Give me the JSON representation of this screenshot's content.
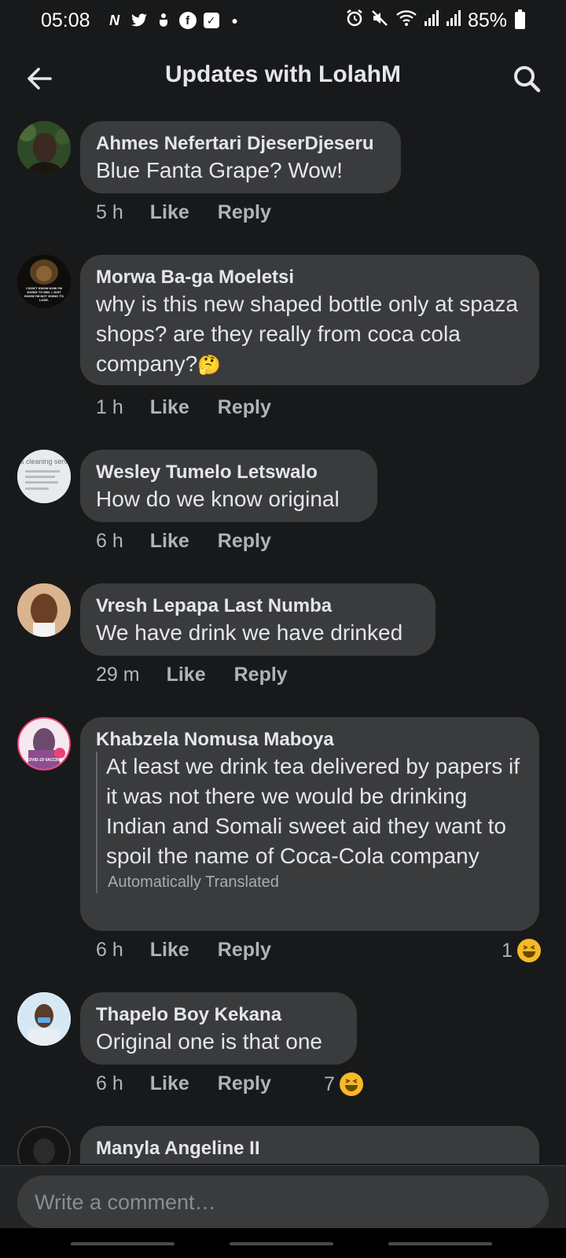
{
  "status_bar": {
    "time": "05:08",
    "battery": "85%"
  },
  "header": {
    "title": "Updates with LolahM"
  },
  "comments": [
    {
      "author": "Ahmes Nefertari DjeserDjeseru",
      "text": "Blue Fanta Grape? Wow!",
      "time": "5 h",
      "like": "Like",
      "reply": "Reply"
    },
    {
      "author": "Morwa Ba-ga Moeletsi",
      "text": "why is this new shaped bottle only at spaza shops? are they really from coca cola company?",
      "emoji": "🤔",
      "time": "1 h",
      "like": "Like",
      "reply": "Reply",
      "avatar_text": "I DON'T KNOW HOW I'M GOING TO WIN. I JUST KNOW I'M NOT GOING TO LOSE."
    },
    {
      "author": "Wesley Tumelo Letswalo",
      "text": "How do we know original",
      "time": "6 h",
      "like": "Like",
      "reply": "Reply",
      "avatar_text": "s cleaning servic"
    },
    {
      "author": "Vresh Lepapa Last Numba",
      "text": "We have drink we have drinked",
      "time": "29 m",
      "like": "Like",
      "reply": "Reply"
    },
    {
      "author": "Khabzela Nomusa Maboya",
      "text": "At least we drink tea delivered by papers if it was not there we would be drinking Indian and Somali sweet aid they want to spoil the name of Coca-Cola company",
      "translated": "Automatically Translated",
      "time": "6 h",
      "like": "Like",
      "reply": "Reply",
      "reactions": "1",
      "avatar_text": "COVID-19 VACCINE"
    },
    {
      "author": "Thapelo Boy Kekana",
      "text": "Original one is that one",
      "time": "6 h",
      "like": "Like",
      "reply": "Reply",
      "reactions": "7"
    },
    {
      "author": "Manyla Angeline II"
    }
  ],
  "composer": {
    "placeholder": "Write a comment…"
  }
}
